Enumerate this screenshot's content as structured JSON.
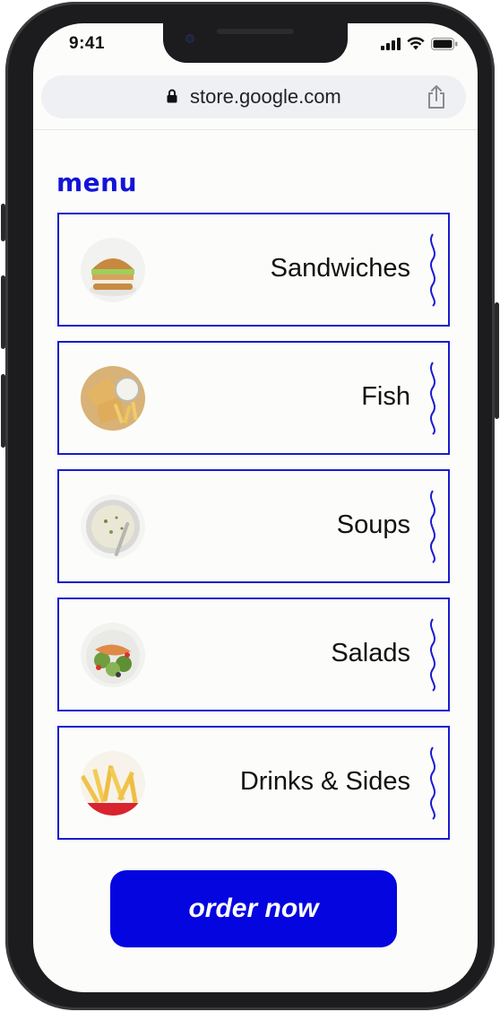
{
  "status_bar": {
    "time": "9:41",
    "icons": [
      "cellular-signal-icon",
      "wifi-icon",
      "battery-icon"
    ]
  },
  "browser": {
    "url": "store.google.com",
    "icons": [
      "lock-icon",
      "share-icon"
    ]
  },
  "menu": {
    "title": "menu",
    "items": [
      {
        "label": "Sandwiches",
        "image": "sandwich-image"
      },
      {
        "label": "Fish",
        "image": "fish-and-chips-image"
      },
      {
        "label": "Soups",
        "image": "soup-bowl-image"
      },
      {
        "label": "Salads",
        "image": "salmon-salad-image"
      },
      {
        "label": "Drinks & Sides",
        "image": "fries-image"
      }
    ]
  },
  "order_button": {
    "label": "order now"
  },
  "colors": {
    "accent": "#1414d8",
    "button": "#0505e0",
    "background": "#fcfcfa",
    "text": "#111111"
  }
}
